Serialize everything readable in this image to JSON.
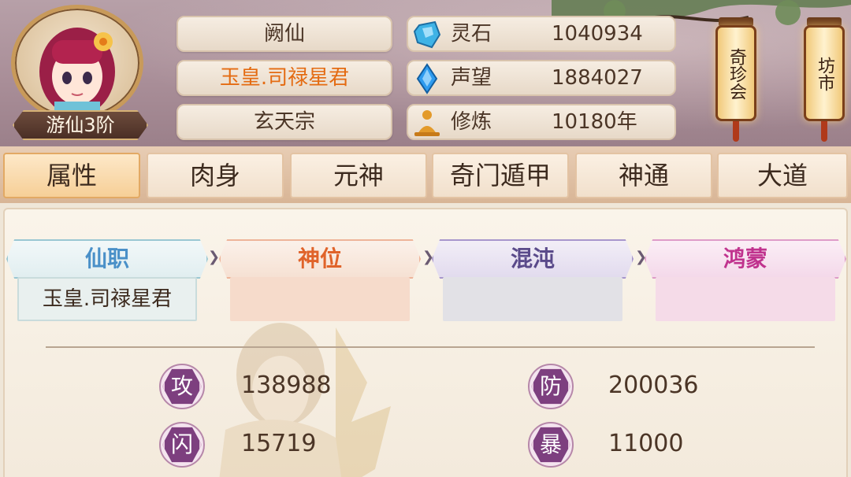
{
  "header": {
    "avatar_rank": "游仙3阶",
    "plates": {
      "name": "阙仙",
      "title": "玉皇.司禄星君",
      "sect": "玄天宗"
    },
    "stats": [
      {
        "icon": "spirit-stone-icon",
        "label": "灵石",
        "value": "1040934"
      },
      {
        "icon": "reputation-crystal-icon",
        "label": "声望",
        "value": "1884027"
      },
      {
        "icon": "meditation-icon",
        "label": "修炼",
        "value": "10180年"
      }
    ],
    "lanterns": [
      {
        "label": "奇珍会"
      },
      {
        "label": "坊市"
      }
    ]
  },
  "tabs": [
    {
      "label": "属性",
      "active": true
    },
    {
      "label": "肉身",
      "active": false
    },
    {
      "label": "元神",
      "active": false
    },
    {
      "label": "奇门遁甲",
      "active": false
    },
    {
      "label": "神通",
      "active": false
    },
    {
      "label": "大道",
      "active": false
    }
  ],
  "ranks": [
    {
      "header": "仙职",
      "value": "玉皇.司禄星君",
      "color": "#4a90c8"
    },
    {
      "header": "神位",
      "value": "",
      "color": "#e0632a"
    },
    {
      "header": "混沌",
      "value": "",
      "color": "#5a4a8a"
    },
    {
      "header": "鸿蒙",
      "value": "",
      "color": "#c0338e"
    }
  ],
  "attributes": [
    {
      "glyph": "攻",
      "value": "138988"
    },
    {
      "glyph": "防",
      "value": "200036"
    },
    {
      "glyph": "闪",
      "value": "15719"
    },
    {
      "glyph": "暴",
      "value": "11000"
    }
  ],
  "colors": {
    "accent_orange": "#e46b12",
    "badge_purple": "#7d3f7f",
    "text_brown": "#4b3526"
  }
}
